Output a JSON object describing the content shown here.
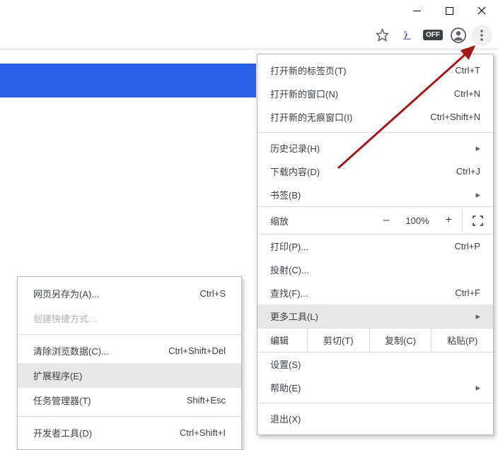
{
  "titlebar": {
    "minimize_tooltip": "Minimize",
    "maximize_tooltip": "Maximize",
    "close_tooltip": "Close"
  },
  "toolbar": {
    "off_badge": "OFF"
  },
  "banner": {},
  "menu": {
    "new_tab": {
      "label": "打开新的标签页(T)",
      "shortcut": "Ctrl+T"
    },
    "new_window": {
      "label": "打开新的窗口(N)",
      "shortcut": "Ctrl+N"
    },
    "incognito": {
      "label": "打开新的无痕窗口(I)",
      "shortcut": "Ctrl+Shift+N"
    },
    "history": {
      "label": "历史记录(H)"
    },
    "downloads": {
      "label": "下载内容(D)",
      "shortcut": "Ctrl+J"
    },
    "bookmarks": {
      "label": "书签(B)"
    },
    "zoom": {
      "label": "缩放",
      "minus": "–",
      "pct": "100%",
      "plus": "+"
    },
    "print": {
      "label": "打印(P)...",
      "shortcut": "Ctrl+P"
    },
    "cast": {
      "label": "投射(C)..."
    },
    "find": {
      "label": "查找(F)...",
      "shortcut": "Ctrl+F"
    },
    "more_tools": {
      "label": "更多工具(L)"
    },
    "edit": {
      "label": "编辑",
      "cut": "剪切(T)",
      "copy": "复制(C)",
      "paste": "粘贴(P)"
    },
    "settings": {
      "label": "设置(S)"
    },
    "help": {
      "label": "帮助(E)"
    },
    "exit": {
      "label": "退出(X)"
    }
  },
  "submenu": {
    "save_page": {
      "label": "网页另存为(A)...",
      "shortcut": "Ctrl+S"
    },
    "create_shortcut": {
      "label": "创建快捷方式…"
    },
    "clear_data": {
      "label": "清除浏览数据(C)...",
      "shortcut": "Ctrl+Shift+Del"
    },
    "extensions": {
      "label": "扩展程序(E)"
    },
    "task_manager": {
      "label": "任务管理器(T)",
      "shortcut": "Shift+Esc"
    },
    "dev_tools": {
      "label": "开发者工具(D)",
      "shortcut": "Ctrl+Shift+I"
    }
  }
}
